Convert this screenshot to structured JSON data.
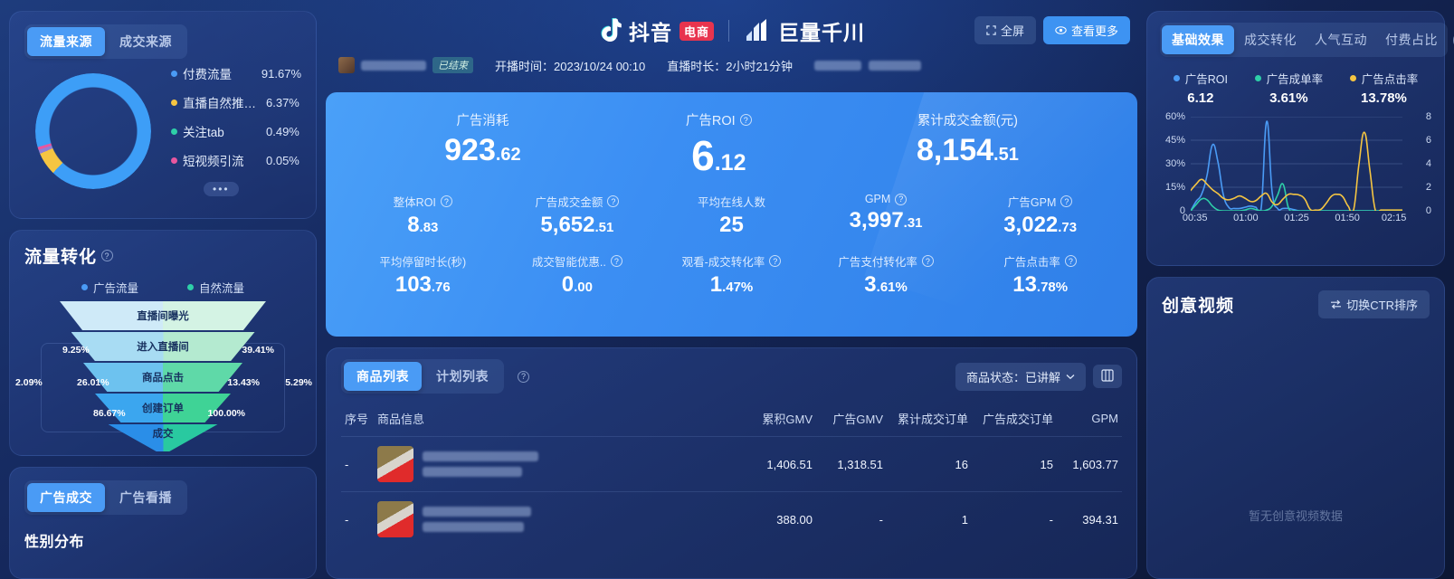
{
  "header": {
    "brand_name": "抖音",
    "brand_badge": "电商",
    "brand_secondary": "巨量千川",
    "fullscreen_label": "全屏",
    "more_label": "查看更多",
    "live_status_tag": "已结束",
    "start_time_label": "开播时间：",
    "start_time_value": "2023/10/24 00:10",
    "duration_label": "直播时长：",
    "duration_value": "2小时21分钟"
  },
  "traffic_source": {
    "tabs": [
      {
        "label": "流量来源",
        "active": true
      },
      {
        "label": "成交来源",
        "active": false
      }
    ],
    "more_dots": "•••",
    "legend": [
      {
        "name": "付费流量",
        "value": "91.67%",
        "color": "#4a9bf5"
      },
      {
        "name": "直播自然推…",
        "value": "6.37%",
        "color": "#f5c542"
      },
      {
        "name": "关注tab",
        "value": "0.49%",
        "color": "#2ecfa8"
      },
      {
        "name": "短视频引流",
        "value": "0.05%",
        "color": "#e8579f"
      }
    ]
  },
  "funnel": {
    "title": "流量转化",
    "legend": [
      {
        "label": "广告流量",
        "color": "#4a9bf5"
      },
      {
        "label": "自然流量",
        "color": "#2ecfa8"
      }
    ],
    "stages": [
      {
        "label": "直播间曝光"
      },
      {
        "label": "进入直播间"
      },
      {
        "label": "商品点击"
      },
      {
        "label": "创建订单"
      },
      {
        "label": "成交"
      }
    ],
    "rates": {
      "ad_enter": "9.25%",
      "nat_enter": "39.41%",
      "ad_click": "26.01%",
      "nat_click": "13.43%",
      "ad_order": "86.67%",
      "nat_order": "100.00%",
      "ad_total": "2.09%",
      "nat_total": "5.29%"
    }
  },
  "gender": {
    "tabs": [
      {
        "label": "广告成交",
        "active": true
      },
      {
        "label": "广告看播",
        "active": false
      }
    ],
    "section_title": "性别分布"
  },
  "kpi": {
    "primary": [
      {
        "label": "广告消耗",
        "int": "923",
        "dec": ".62",
        "help": false,
        "hero": false
      },
      {
        "label": "广告ROI",
        "int": "6",
        "dec": ".12",
        "help": true,
        "hero": true
      },
      {
        "label": "累计成交金额(元)",
        "int": "8,154",
        "dec": ".51",
        "help": false,
        "hero": false
      }
    ],
    "row2": [
      {
        "label": "整体ROI",
        "int": "8",
        "dec": ".83",
        "help": true
      },
      {
        "label": "广告成交金额",
        "int": "5,652",
        "dec": ".51",
        "help": true
      },
      {
        "label": "平均在线人数",
        "int": "25",
        "dec": "",
        "help": false
      },
      {
        "label": "GPM",
        "int": "3,997",
        "dec": ".31",
        "help": true
      },
      {
        "label": "广告GPM",
        "int": "3,022",
        "dec": ".73",
        "help": true
      }
    ],
    "row3": [
      {
        "label": "平均停留时长(秒)",
        "int": "103",
        "dec": ".76",
        "help": false
      },
      {
        "label": "成交智能优惠..",
        "int": "0",
        "dec": ".00",
        "help": true
      },
      {
        "label": "观看-成交转化率",
        "int": "1",
        "dec": ".47%",
        "help": true
      },
      {
        "label": "广告支付转化率",
        "int": "3",
        "dec": ".61%",
        "help": true
      },
      {
        "label": "广告点击率",
        "int": "13",
        "dec": ".78%",
        "help": true
      }
    ]
  },
  "product_table": {
    "tabs": [
      {
        "label": "商品列表",
        "active": true
      },
      {
        "label": "计划列表",
        "active": false
      }
    ],
    "status_filter": "商品状态：已讲解",
    "columns": [
      "序号",
      "商品信息",
      "累积GMV",
      "广告GMV",
      "累计成交订单",
      "广告成交订单",
      "GPM"
    ],
    "rows": [
      {
        "index": "-",
        "gmv": "1,406.51",
        "ad_gmv": "1,318.51",
        "orders": "16",
        "ad_orders": "15",
        "gpm": "1,603.77"
      },
      {
        "index": "-",
        "gmv": "388.00",
        "ad_gmv": "-",
        "orders": "1",
        "ad_orders": "-",
        "gpm": "394.31"
      }
    ]
  },
  "right_chart": {
    "tabs": [
      {
        "label": "基础效果",
        "active": true
      },
      {
        "label": "成交转化",
        "active": false
      },
      {
        "label": "人气互动",
        "active": false
      },
      {
        "label": "付费占比",
        "active": false
      }
    ],
    "legend": [
      {
        "name": "广告ROI",
        "value": "6.12",
        "color": "#4a9bf5"
      },
      {
        "name": "广告成单率",
        "value": "3.61%",
        "color": "#2ecfa8"
      },
      {
        "name": "广告点击率",
        "value": "13.78%",
        "color": "#f5c542"
      }
    ]
  },
  "chart_data": {
    "type": "line",
    "title": "基础效果",
    "xlabel": "",
    "ylabel": "",
    "grid": true,
    "legend_position": "top",
    "y_left_ticks": [
      "0",
      "15%",
      "30%",
      "45%",
      "60%"
    ],
    "y_right_ticks": [
      "0",
      "2",
      "4",
      "6",
      "8"
    ],
    "ylim_left": [
      0,
      60
    ],
    "ylim_right": [
      0,
      8
    ],
    "x_ticks": [
      "00:35",
      "01:00",
      "01:25",
      "01:50",
      "02:15"
    ],
    "series": [
      {
        "name": "广告ROI",
        "color": "#4a9bf5",
        "axis": "right",
        "values": [
          0,
          0.8,
          1.4,
          3.0,
          5.6,
          4.2,
          1.4,
          0.3,
          0.2,
          0.2,
          0.3,
          0.4,
          0.3,
          0.3,
          7.6,
          1.6,
          0.2,
          0.2,
          0.2,
          0.1,
          0,
          0,
          0,
          0,
          0,
          0,
          0,
          0,
          0,
          0,
          0,
          0,
          0,
          0,
          0,
          0,
          0,
          0,
          0,
          0
        ]
      },
      {
        "name": "广告成单率",
        "color": "#2ecfa8",
        "axis": "left",
        "values": [
          0,
          4,
          7.5,
          7,
          3,
          0.5,
          0,
          0,
          0,
          0,
          0.5,
          1.5,
          0.8,
          0,
          0.5,
          3,
          10,
          17,
          2,
          0,
          0,
          0,
          0,
          0,
          0,
          0,
          0,
          0,
          0,
          0,
          0,
          0,
          0,
          0,
          0,
          0,
          0,
          0,
          0,
          0
        ]
      },
      {
        "name": "广告点击率",
        "color": "#f5c542",
        "axis": "left",
        "values": [
          13,
          17,
          20,
          17,
          13.5,
          11,
          8,
          7,
          8,
          9.5,
          8,
          6,
          6.5,
          9.5,
          11,
          5.5,
          4,
          7.5,
          10.5,
          10.5,
          10,
          7.5,
          1,
          0.5,
          1,
          5,
          9.5,
          10.5,
          9,
          3,
          0.5,
          30,
          50,
          26,
          0.5,
          0.5,
          0.5,
          0.5,
          0.5,
          0.5
        ]
      }
    ]
  },
  "creative_video": {
    "title": "创意视频",
    "sort_button": "切换CTR排序",
    "empty_text": "暂无创意视频数据"
  }
}
